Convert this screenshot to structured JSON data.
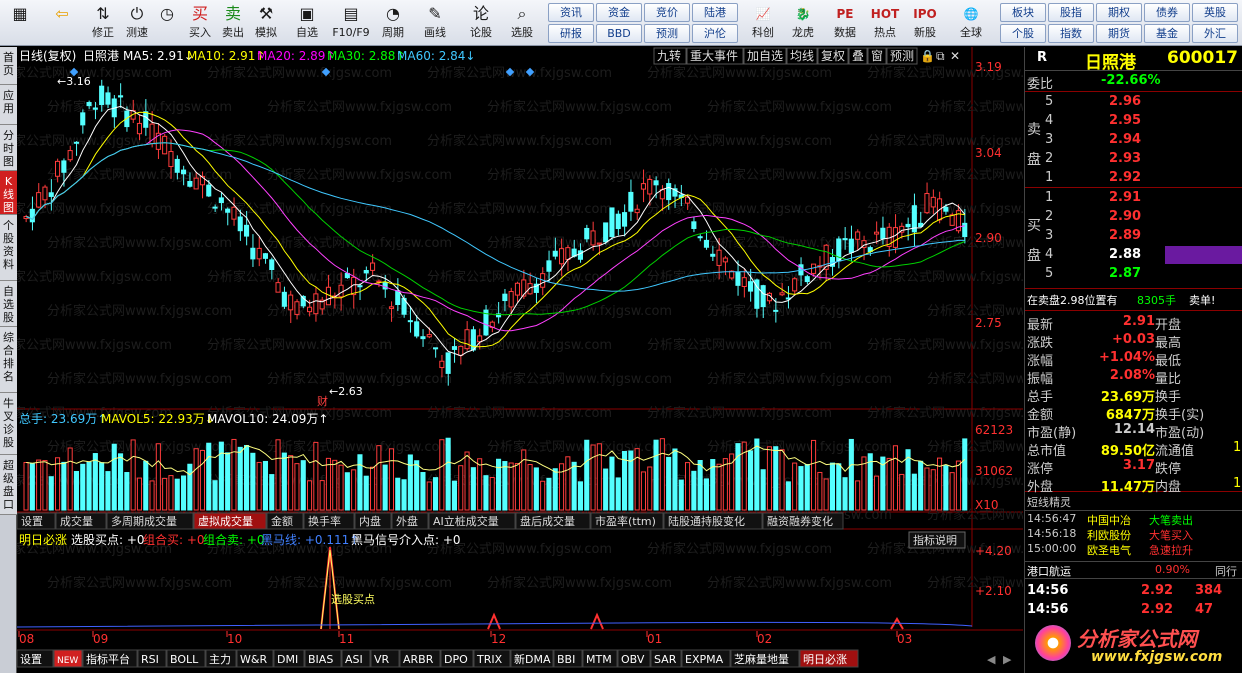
{
  "toolbar": {
    "big": [
      {
        "label": "",
        "icon": "apps-grid-icon",
        "glyph": "▦"
      },
      {
        "label": "",
        "icon": "back-arrow-icon",
        "glyph": "⇦"
      },
      {
        "label": "修正",
        "icon": "arrows-icon",
        "glyph": "⇅"
      },
      {
        "label": "测速",
        "icon": "power-icon",
        "glyph": "⏻"
      },
      {
        "label": "",
        "icon": "clock-icon",
        "glyph": "◷"
      },
      {
        "label": "买入",
        "icon": "buy-icon",
        "glyph": "买"
      },
      {
        "label": "卖出",
        "icon": "sell-icon",
        "glyph": "卖"
      },
      {
        "label": "模拟",
        "icon": "hammer-icon",
        "glyph": "⚒"
      },
      {
        "label": "自选",
        "icon": "folder-icon",
        "glyph": "▣"
      },
      {
        "label": "F10/F9",
        "icon": "document-icon",
        "glyph": "▤"
      },
      {
        "label": "周期",
        "icon": "period-icon",
        "glyph": "◔"
      },
      {
        "label": "画线",
        "icon": "pencil-icon",
        "glyph": "✎"
      },
      {
        "label": "论股",
        "icon": "discuss-icon",
        "glyph": "论"
      },
      {
        "label": "选股",
        "icon": "magnifier-icon",
        "glyph": "⌕"
      }
    ],
    "grid": [
      {
        "label": "资讯"
      },
      {
        "label": "资金"
      },
      {
        "label": "竞价"
      },
      {
        "label": "陆港"
      },
      {
        "label": "研报"
      },
      {
        "label": "BBD"
      },
      {
        "label": "预测"
      },
      {
        "label": "沪伦"
      }
    ],
    "big2": [
      {
        "label": "科创",
        "icon": "chart-icon",
        "glyph": "📈"
      },
      {
        "label": "龙虎",
        "icon": "dragon-icon",
        "glyph": "🐉"
      },
      {
        "label": "数据",
        "icon": "pe-icon",
        "glyph": "PE"
      },
      {
        "label": "热点",
        "icon": "hot-icon",
        "glyph": "HOT"
      },
      {
        "label": "新股",
        "icon": "ipo-icon",
        "glyph": "IPO"
      },
      {
        "label": "全球",
        "icon": "globe-icon",
        "glyph": "🌐"
      }
    ],
    "grid2": [
      {
        "label": "板块"
      },
      {
        "label": "股指"
      },
      {
        "label": "期权"
      },
      {
        "label": "债券"
      },
      {
        "label": "英股"
      },
      {
        "label": "个股"
      },
      {
        "label": "指数"
      },
      {
        "label": "期货"
      },
      {
        "label": "基金"
      },
      {
        "label": "外汇"
      }
    ]
  },
  "left_tabs": [
    {
      "label": "首页"
    },
    {
      "label": "应用"
    },
    {
      "label": "分时图"
    },
    {
      "label": "K线图"
    },
    {
      "label": "个股资料"
    },
    {
      "label": "自选股"
    },
    {
      "label": "综合排名"
    },
    {
      "label": "牛叉诊股"
    },
    {
      "label": "超级盘口"
    }
  ],
  "main_header": {
    "period": "日线(复权)",
    "name": "日照港",
    "ma5": "MA5: 2.91↓",
    "ma10": "MA10: 2.91↑",
    "ma20": "MA20: 2.89↑",
    "ma30": "MA30: 2.88↑",
    "ma60": "MA60: 2.84↓",
    "buttons": [
      "九转",
      "重大事件",
      "加自选",
      "均线",
      "复权",
      "叠",
      "窗",
      "预测"
    ],
    "lock": "🔒",
    "copy": "⧉",
    "close": "✕"
  },
  "price_axis": [
    "3.19",
    "3.04",
    "2.90",
    "2.75"
  ],
  "annotations": {
    "high": "3.16",
    "low": "2.63",
    "cai": "财"
  },
  "watermark": "分析家公式网www.fxjgsw.com",
  "volume_header": {
    "total": "总手: 23.69万↑",
    "mavol5": "MAVOL5: 22.93万↓",
    "mavol10": "MAVOL10: 24.09万↑"
  },
  "volume_axis": [
    "62123",
    "31062",
    "X10"
  ],
  "sub_tabs": [
    "设置",
    "成交量",
    "多周期成交量",
    "虚拟成交量",
    "金额",
    "换手率",
    "内盘",
    "外盘",
    "AI立桩成交量",
    "盘后成交量",
    "市盈率(ttm)",
    "陆股通持股变化",
    "融资融券变化"
  ],
  "sub_tab_active": "虚拟成交量",
  "indicator_header": {
    "name": "明日必涨",
    "buy": "选股买点: +0",
    "combo_buy": "组合买: +0",
    "combo_sell": "组合卖: +0",
    "black_horse": "黑马线: +0.111↑",
    "black_horse_signal": "黑马信号介入点: +0",
    "explain": "指标说明"
  },
  "indicator_axis": [
    "+4.20",
    "+2.10"
  ],
  "indicator_label": "选股买点",
  "date_axis": [
    "08",
    "09",
    "10",
    "11",
    "12",
    "01",
    "02",
    "03"
  ],
  "bottom_tabs": [
    "设置",
    "NEW",
    "指标平台",
    "RSI",
    "BOLL",
    "主力",
    "W&R",
    "DMI",
    "BIAS",
    "ASI",
    "VR",
    "ARBR",
    "DPO",
    "TRIX",
    "新DMA",
    "BBI",
    "MTM",
    "OBV",
    "SAR",
    "EXPMA",
    "芝麻量地量",
    "明日必涨"
  ],
  "bottom_tab_active": "明日必涨",
  "panel": {
    "r": "R",
    "name": "日照港",
    "code": "600017",
    "weibi_label": "委比",
    "weibi": "-22.66%",
    "sell_label": "卖盘",
    "buy_label": "买盘",
    "sell": [
      {
        "lvl": "5",
        "price": "2.96"
      },
      {
        "lvl": "4",
        "price": "2.95"
      },
      {
        "lvl": "3",
        "price": "2.94"
      },
      {
        "lvl": "2",
        "price": "2.93"
      },
      {
        "lvl": "1",
        "price": "2.92"
      }
    ],
    "buy": [
      {
        "lvl": "1",
        "price": "2.91"
      },
      {
        "lvl": "2",
        "price": "2.90"
      },
      {
        "lvl": "3",
        "price": "2.89"
      },
      {
        "lvl": "4",
        "price": "2.88"
      },
      {
        "lvl": "5",
        "price": "2.87"
      }
    ],
    "pos_line": "在卖盘2.98位置有",
    "pos_qty": "8305手",
    "pos_side": "卖单!",
    "stats": [
      {
        "k1": "最新",
        "v1": "2.91",
        "k2": "开盘",
        "v2": ""
      },
      {
        "k1": "涨跌",
        "v1": "+0.03",
        "k2": "最高",
        "v2": ""
      },
      {
        "k1": "涨幅",
        "v1": "+1.04%",
        "k2": "最低",
        "v2": ""
      },
      {
        "k1": "振幅",
        "v1": "2.08%",
        "k2": "量比",
        "v2": ""
      },
      {
        "k1": "总手",
        "v1": "23.69万",
        "k2": "换手",
        "v2": ""
      },
      {
        "k1": "金额",
        "v1": "6847万",
        "k2": "换手(实)",
        "v2": ""
      },
      {
        "k1": "市盈(静)",
        "v1": "12.14",
        "k2": "市盈(动)",
        "v2": ""
      },
      {
        "k1": "总市值",
        "v1": "89.50亿",
        "k2": "流通值",
        "v2": "1"
      },
      {
        "k1": "涨停",
        "v1": "3.17",
        "k2": "跌停",
        "v2": ""
      },
      {
        "k1": "外盘",
        "v1": "11.47万",
        "k2": "内盘",
        "v2": "1"
      }
    ],
    "short_title": "短线精灵",
    "short": [
      {
        "t": "14:56:47",
        "n": "中国中冶",
        "a": "大笔卖出"
      },
      {
        "t": "14:56:18",
        "n": "利欧股份",
        "a": "大笔买入"
      },
      {
        "t": "15:00:00",
        "n": "欧圣电气",
        "a": "急速拉升"
      }
    ],
    "sector": "港口航运",
    "sector_pct": "0.90%",
    "sector_tab": "同行",
    "ticks": [
      {
        "t": "14:56",
        "p": "2.92",
        "q": "384"
      },
      {
        "t": "14:56",
        "p": "2.92",
        "q": "47"
      }
    ],
    "logo_text": "分析家公式网",
    "logo_url": "www.fxjgsw.com"
  },
  "chart_data": {
    "type": "candlestick",
    "title": "日照港 600017 日线(复权)",
    "x": [
      "08",
      "09",
      "10",
      "11",
      "12",
      "01",
      "02",
      "03"
    ],
    "y_ticks": [
      3.19,
      3.04,
      2.9,
      2.75
    ],
    "high": 3.16,
    "low": 2.63,
    "latest": 2.91,
    "ma": {
      "MA5": 2.91,
      "MA10": 2.91,
      "MA20": 2.89,
      "MA30": 2.88,
      "MA60": 2.84
    },
    "volume_ticks": [
      62123,
      31062
    ]
  }
}
